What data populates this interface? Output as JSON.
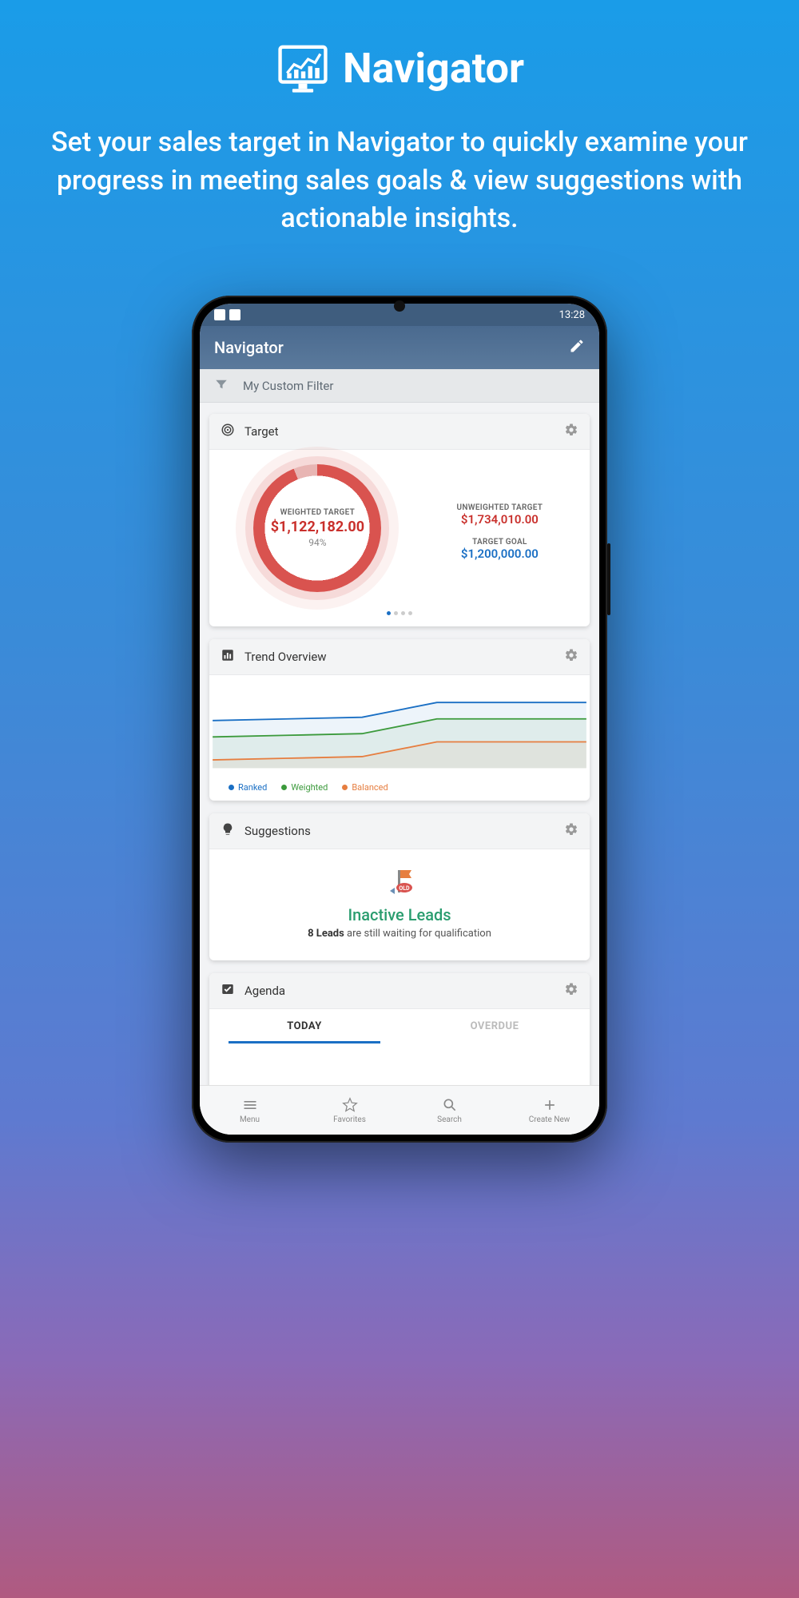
{
  "promo": {
    "title": "Navigator",
    "description": "Set your sales target in Navigator to quickly examine your progress in meeting sales goals & view suggestions with actionable insights."
  },
  "statusbar": {
    "time": "13:28"
  },
  "appbar": {
    "title": "Navigator"
  },
  "filter": {
    "label": "My Custom Filter"
  },
  "target": {
    "title": "Target",
    "weighted_label": "WEIGHTED TARGET",
    "weighted_value": "$1,122,182.00",
    "weighted_pct": "94%",
    "unweighted_label": "UNWEIGHTED TARGET",
    "unweighted_value": "$1,734,010.00",
    "goal_label": "TARGET GOAL",
    "goal_value": "$1,200,000.00"
  },
  "trend": {
    "title": "Trend Overview",
    "legend": {
      "ranked": "Ranked",
      "weighted": "Weighted",
      "balanced": "Balanced"
    }
  },
  "suggestions": {
    "title": "Suggestions",
    "headline": "Inactive Leads",
    "bold": "8 Leads",
    "rest": " are still waiting for qualification",
    "badge": "OLD"
  },
  "agenda": {
    "title": "Agenda",
    "tab_today": "TODAY",
    "tab_overdue": "OVERDUE"
  },
  "nav": {
    "menu": "Menu",
    "favorites": "Favorites",
    "search": "Search",
    "create": "Create New"
  },
  "chart_data": {
    "type": "line",
    "title": "Trend Overview",
    "x": [
      0,
      1,
      2,
      3,
      4,
      5
    ],
    "series": [
      {
        "name": "Ranked",
        "color": "#1a6fc4",
        "values": [
          58,
          60,
          62,
          80,
          80,
          80
        ]
      },
      {
        "name": "Weighted",
        "color": "#3c9a3c",
        "values": [
          38,
          40,
          42,
          60,
          60,
          60
        ]
      },
      {
        "name": "Balanced",
        "color": "#e67e40",
        "values": [
          10,
          12,
          14,
          32,
          32,
          32
        ]
      }
    ],
    "ylim": [
      0,
      100
    ]
  }
}
